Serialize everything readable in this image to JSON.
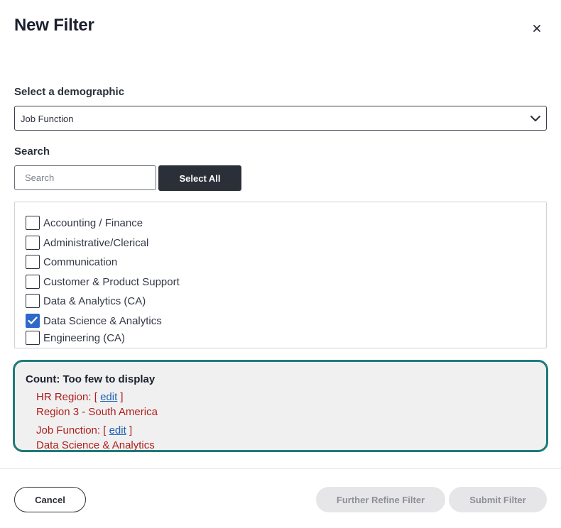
{
  "modal": {
    "title": "New Filter",
    "close_icon": "close-icon"
  },
  "demographic": {
    "label": "Select a demographic",
    "selected": "Job Function",
    "chevron_icon": "chevron-down-icon"
  },
  "search": {
    "label": "Search",
    "placeholder": "Search",
    "value": "",
    "select_all_label": "Select All"
  },
  "options": [
    {
      "label": "Accounting / Finance",
      "checked": false
    },
    {
      "label": "Administrative/Clerical",
      "checked": false
    },
    {
      "label": "Communication",
      "checked": false
    },
    {
      "label": "Customer & Product Support",
      "checked": false
    },
    {
      "label": "Data & Analytics (CA)",
      "checked": false
    },
    {
      "label": "Data Science & Analytics",
      "checked": true
    },
    {
      "label": "Engineering (CA)",
      "checked": false
    }
  ],
  "count": {
    "title": "Count: Too few to display",
    "criteria": [
      {
        "name": "HR Region:",
        "bracket_open": "[",
        "edit": "edit",
        "bracket_close": "]",
        "value": "Region 3 - South America"
      },
      {
        "name": "Job Function:",
        "bracket_open": "[",
        "edit": "edit",
        "bracket_close": "]",
        "value": "Data Science & Analytics"
      }
    ]
  },
  "footer": {
    "cancel_label": "Cancel",
    "refine_label": "Further Refine Filter",
    "submit_label": "Submit Filter"
  },
  "colors": {
    "accent_checkbox": "#2e69c9",
    "count_border": "#1f7a7a",
    "criteria_text": "#b01e1e",
    "link": "#1f5fb4",
    "dark_button": "#2b2f38"
  }
}
